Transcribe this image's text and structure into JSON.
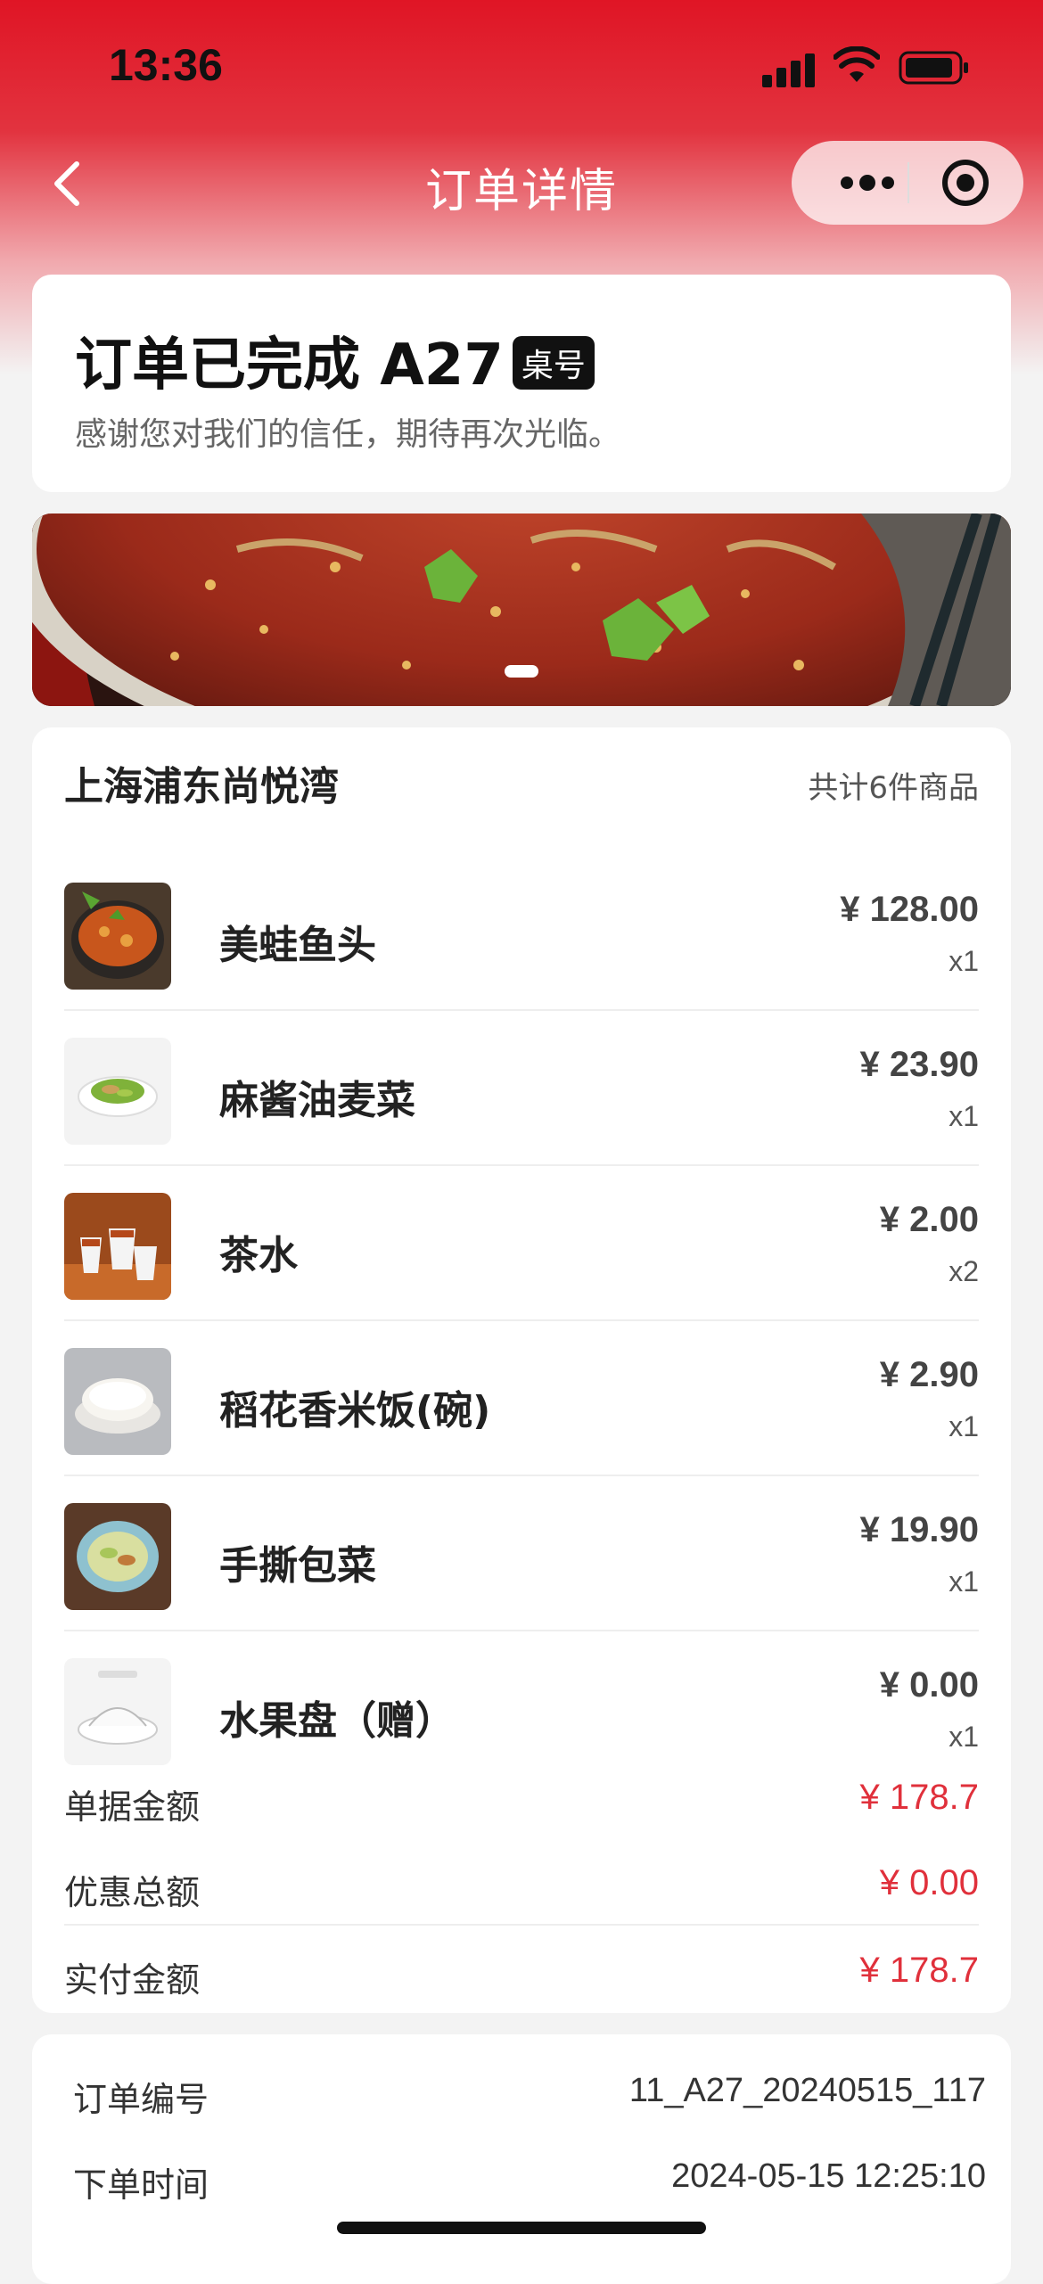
{
  "status_bar": {
    "time": "13:36"
  },
  "nav": {
    "title": "订单详情"
  },
  "order_status": {
    "title": "订单已完成 A27",
    "table_badge": "桌号",
    "subtitle": "感谢您对我们的信任，期待再次光临。"
  },
  "order": {
    "shop_name": "上海浦东尚悦湾",
    "item_count": "共计6件商品",
    "items": [
      {
        "name": "美蛙鱼头",
        "price": "¥ 128.00",
        "qty": "x1"
      },
      {
        "name": "麻酱油麦菜",
        "price": "¥ 23.90",
        "qty": "x1"
      },
      {
        "name": "茶水",
        "price": "¥ 2.00",
        "qty": "x2"
      },
      {
        "name": "稻花香米饭(碗)",
        "price": "¥ 2.90",
        "qty": "x1"
      },
      {
        "name": "手撕包菜",
        "price": "¥ 19.90",
        "qty": "x1"
      },
      {
        "name": "水果盘（赠）",
        "price": "¥ 0.00",
        "qty": "x1"
      }
    ],
    "summary": {
      "bill_label": "单据金额",
      "bill_value": "¥ 178.7",
      "discount_label": "优惠总额",
      "discount_value": "¥ 0.00",
      "paid_label": "实付金额",
      "paid_value": "¥ 178.7"
    }
  },
  "info": {
    "order_no_label": "订单编号",
    "order_no": "11_A27_20240515_117",
    "order_time_label": "下单时间",
    "order_time": "2024-05-15 12:25:10"
  },
  "colors": {
    "accent": "#e0303b",
    "header": "#e01525"
  }
}
